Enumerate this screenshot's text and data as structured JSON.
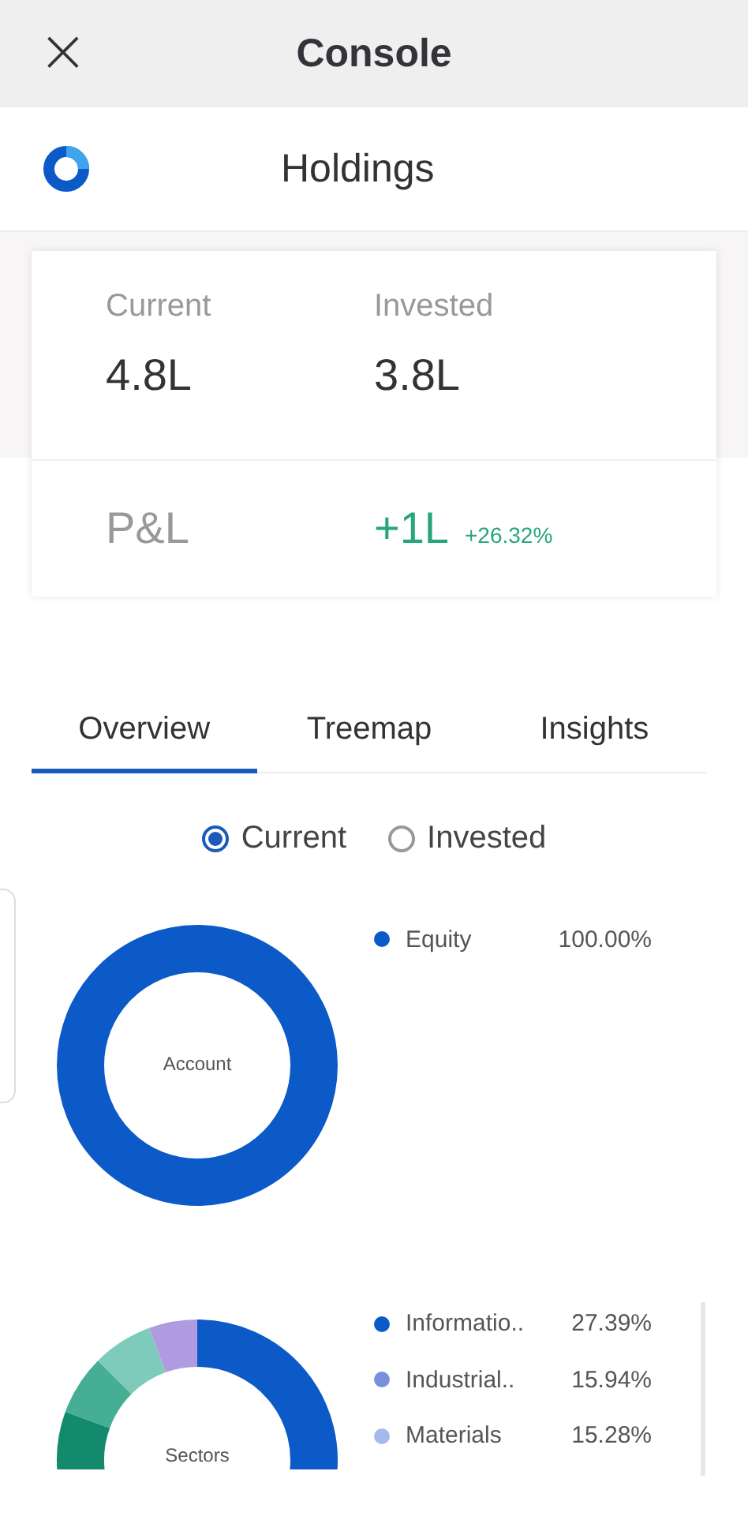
{
  "header": {
    "title": "Console",
    "close": "×"
  },
  "page": {
    "title": "Holdings"
  },
  "summary": {
    "stats": [
      {
        "label": "Current",
        "value": "4.8L"
      },
      {
        "label": "Invested",
        "value": "3.8L"
      }
    ],
    "pnl": {
      "label": "P&L",
      "value": "+1L",
      "change": "+26.32%"
    }
  },
  "tabs": [
    {
      "label": "Overview",
      "selected": true
    },
    {
      "label": "Treemap",
      "selected": false
    },
    {
      "label": "Insights",
      "selected": false
    }
  ],
  "view_options": [
    {
      "label": "Current",
      "selected": true
    },
    {
      "label": "Invested",
      "selected": false
    }
  ],
  "account": {
    "center_label": "Account",
    "legend": [
      {
        "label": "Equity",
        "value": "100.00%",
        "color": "#0c5ac8"
      }
    ]
  },
  "sectors": {
    "center_label": "Sectors",
    "legend": [
      {
        "label": "Informatio..",
        "value": "27.39%",
        "color": "#0c5ac8"
      },
      {
        "label": "Industrial..",
        "value": "15.94%",
        "color": "#7891de"
      },
      {
        "label": "Materials",
        "value": "15.28%",
        "color": "#a6b9ec"
      }
    ]
  }
}
